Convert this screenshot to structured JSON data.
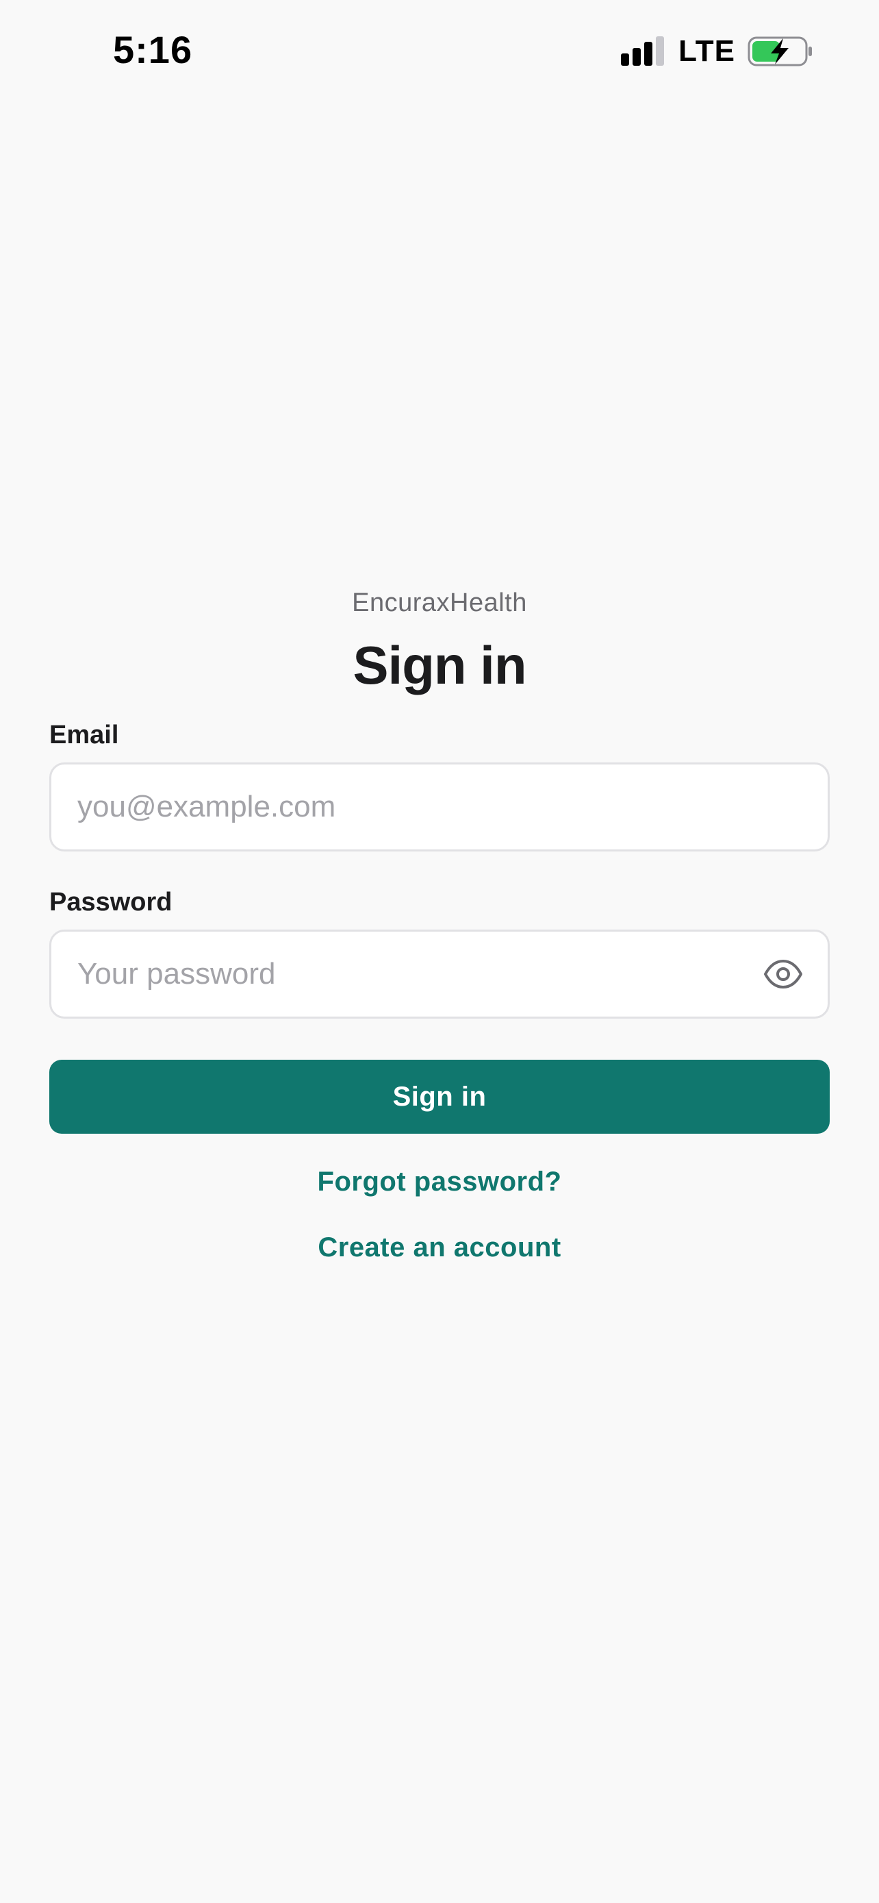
{
  "status_bar": {
    "time": "5:16",
    "network": "LTE",
    "icons": [
      "signal-bars-icon",
      "battery-charging-icon"
    ]
  },
  "brand": {
    "name": "EncuraxHealth"
  },
  "title": "Sign in",
  "form": {
    "email": {
      "label": "Email",
      "value": "",
      "placeholder": "you@example.com"
    },
    "password": {
      "label": "Password",
      "value": "",
      "placeholder": "Your password",
      "toggle_icon": "eye-icon"
    },
    "submit_label": "Sign in"
  },
  "links": {
    "forgot_password": "Forgot password?",
    "create_account": "Create an account"
  },
  "colors": {
    "accent": "#10776e",
    "background": "#f9f9f9",
    "battery_fill": "#34c759"
  }
}
